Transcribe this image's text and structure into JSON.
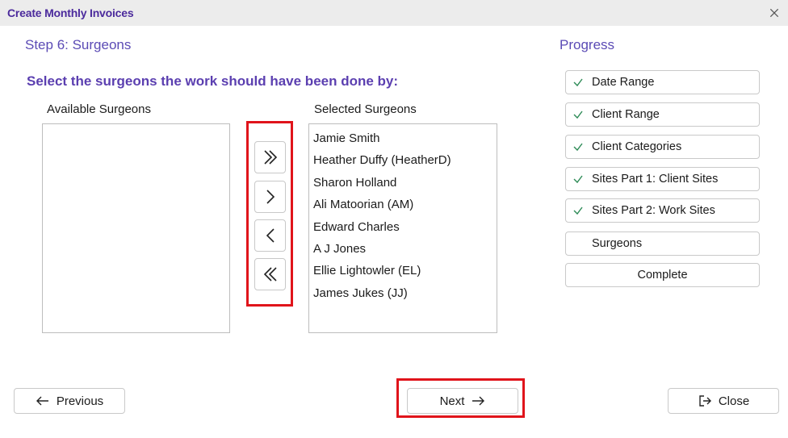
{
  "window": {
    "title": "Create Monthly Invoices",
    "close_icon": "close-icon"
  },
  "step": {
    "title": "Step 6: Surgeons",
    "instruction": "Select the surgeons the work should have been done by:"
  },
  "available": {
    "label": "Available Surgeons",
    "items": []
  },
  "selected": {
    "label": "Selected Surgeons",
    "items": [
      "Jamie Smith",
      "Heather Duffy (HeatherD)",
      "Sharon Holland",
      "Ali Matoorian (AM)",
      "Edward Charles",
      "A J Jones",
      "Ellie Lightowler (EL)",
      "James Jukes (JJ)"
    ]
  },
  "move_buttons": [
    {
      "name": "move-all-right-button",
      "icon": "double-chevron-right-icon"
    },
    {
      "name": "move-right-button",
      "icon": "chevron-right-icon"
    },
    {
      "name": "move-left-button",
      "icon": "chevron-left-icon"
    },
    {
      "name": "move-all-left-button",
      "icon": "double-chevron-left-icon"
    }
  ],
  "progress": {
    "title": "Progress",
    "steps": [
      {
        "label": "Date Range",
        "done": true
      },
      {
        "label": "Client Range",
        "done": true
      },
      {
        "label": "Client Categories",
        "done": true
      },
      {
        "label": "Sites Part 1: Client Sites",
        "done": true
      },
      {
        "label": "Sites Part 2: Work Sites",
        "done": true
      },
      {
        "label": "Surgeons",
        "done": false,
        "current": true
      },
      {
        "label": "Complete",
        "done": false
      }
    ]
  },
  "footer": {
    "previous_label": "Previous",
    "next_label": "Next",
    "close_label": "Close"
  },
  "colors": {
    "accent": "#5b3fb0",
    "highlight": "#e0141b",
    "check": "#2e8b57"
  }
}
